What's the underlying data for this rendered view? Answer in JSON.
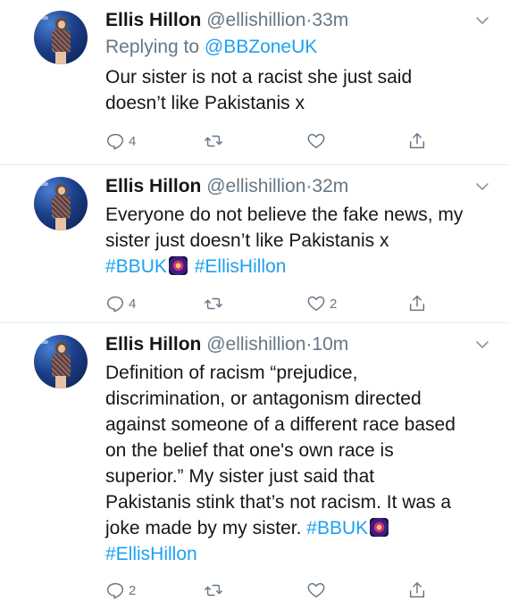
{
  "tweets": [
    {
      "name": "Ellis Hillon",
      "handle": "@ellishillion",
      "separator": "·",
      "time": "33m",
      "replying_prefix": "Replying to",
      "replying_to": "@BBZoneUK",
      "text_lines": [
        "Our sister is not a racist she just said",
        "doesn’t like Pakistanis x"
      ],
      "reply_count": "4",
      "retweet_count": "",
      "like_count": ""
    },
    {
      "name": "Ellis Hillon",
      "handle": "@ellishillion",
      "separator": "·",
      "time": "32m",
      "text_lines": [
        "Everyone do not believe the fake news, my",
        "sister just doesn’t like Pakistanis x"
      ],
      "hashtags": [
        "#BBUK",
        "#EllisHillon"
      ],
      "reply_count": "4",
      "retweet_count": "",
      "like_count": "2"
    },
    {
      "name": "Ellis Hillon",
      "handle": "@ellishillion",
      "separator": "·",
      "time": "10m",
      "text_lines": [
        "Definition of racism “prejudice,",
        "discrimination, or antagonism directed",
        "against someone of a different race based",
        "on the belief that one's own race is",
        "superior.” My sister just said that",
        "Pakistanis stink that’s not racism. It was a",
        "joke made by my sister."
      ],
      "hashtags": [
        "#BBUK",
        "#EllisHillon"
      ],
      "reply_count": "2",
      "retweet_count": "",
      "like_count": ""
    }
  ],
  "icons": {
    "reply": "reply-icon",
    "retweet": "retweet-icon",
    "like": "heart-icon",
    "share": "share-icon",
    "more": "chevron-down-icon"
  },
  "colors": {
    "link": "#1da1f2",
    "secondary_text": "#657786",
    "divider": "#e6ecf0"
  }
}
